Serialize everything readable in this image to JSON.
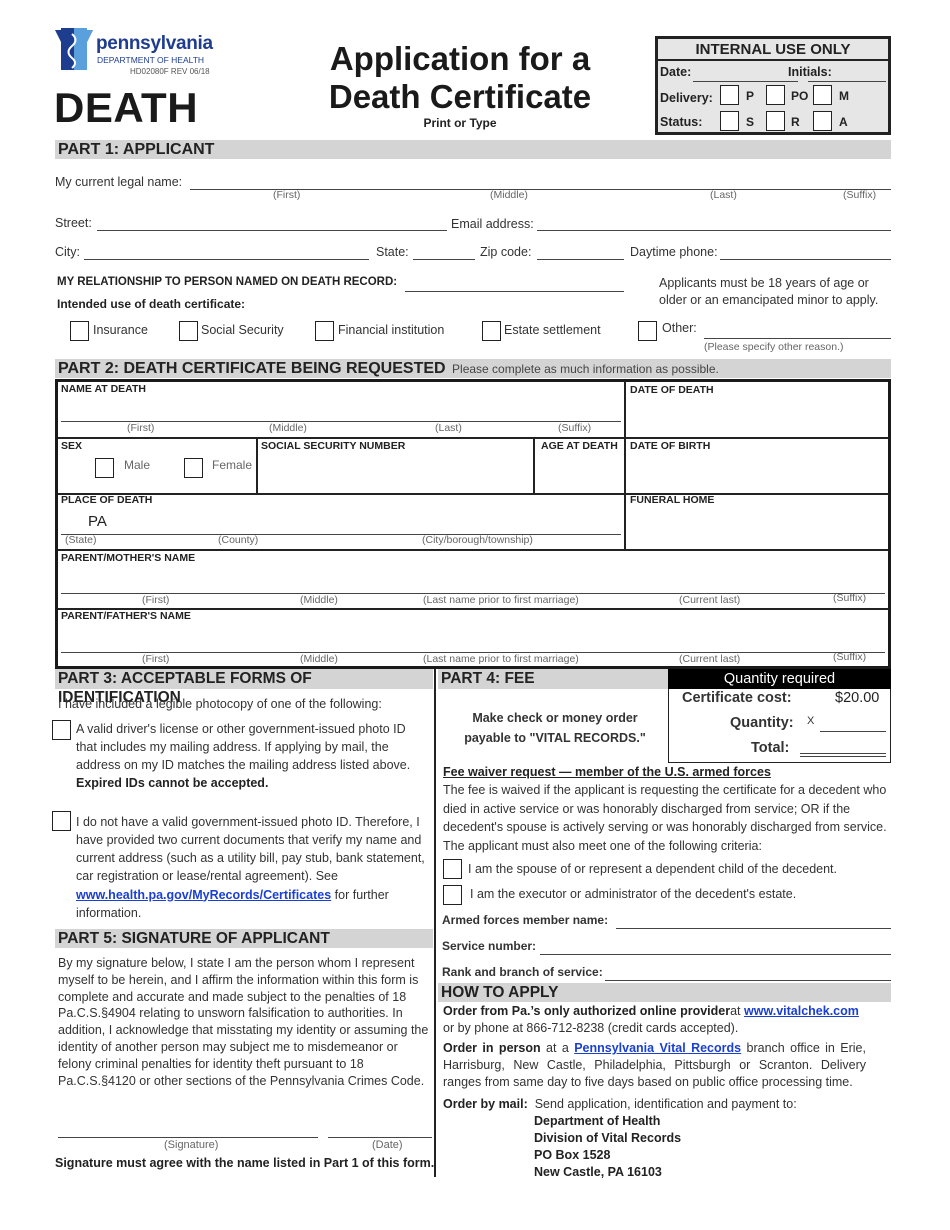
{
  "header": {
    "logo": {
      "name": "pennsylvania",
      "subtitle": "DEPARTMENT OF HEALTH",
      "form_code": "HD02080F REV 06/18"
    },
    "record_type": "DEATH",
    "title_line1": "Application for a",
    "title_line2": "Death Certificate",
    "subtitle": "Print or Type",
    "internal": {
      "title": "INTERNAL USE ONLY",
      "date_label": "Date:",
      "initials_label": "Initials:",
      "delivery_label": "Delivery:",
      "delivery_options": [
        "P",
        "PO",
        "M"
      ],
      "status_label": "Status:",
      "status_options": [
        "S",
        "R",
        "A"
      ]
    }
  },
  "part1": {
    "title": "PART 1: APPLICANT",
    "legal_name_label": "My current legal name:",
    "name_hints": [
      "(First)",
      "(Middle)",
      "(Last)",
      "(Suffix)"
    ],
    "street_label": "Street:",
    "email_label": "Email address:",
    "city_label": "City:",
    "state_label": "State:",
    "zip_label": "Zip code:",
    "phone_label": "Daytime phone:",
    "relationship_label": "MY RELATIONSHIP TO PERSON NAMED ON DEATH RECORD:",
    "age_note_line1": "Applicants must be 18 years of age or",
    "age_note_line2": "older or an emancipated minor to apply.",
    "intended_use_label": "Intended use of death certificate:",
    "uses": [
      "Insurance",
      "Social Security",
      "Financial institution",
      "Estate settlement"
    ],
    "other_label": "Other:",
    "other_hint": "(Please specify other reason.)"
  },
  "part2": {
    "title": "PART 2: DEATH CERTIFICATE BEING REQUESTED",
    "note": "Please complete as much information as possible.",
    "name_at_death": "NAME AT DEATH",
    "name_hints": [
      "(First)",
      "(Middle)",
      "(Last)",
      "(Suffix)"
    ],
    "date_of_death": "DATE OF DEATH",
    "sex": "SEX",
    "sex_options": [
      "Male",
      "Female"
    ],
    "ssn": "SOCIAL SECURITY NUMBER",
    "age_at_death": "AGE AT DEATH",
    "date_of_birth": "DATE OF BIRTH",
    "place_of_death": "PLACE OF DEATH",
    "place_state_value": "PA",
    "place_hints": [
      "(State)",
      "(County)",
      "(City/borough/township)"
    ],
    "funeral_home": "FUNERAL HOME",
    "mother": "PARENT/MOTHER'S NAME",
    "father": "PARENT/FATHER'S NAME",
    "parent_hints": [
      "(First)",
      "(Middle)",
      "(Last name prior to first marriage)",
      "(Current last)",
      "(Suffix)"
    ]
  },
  "part3": {
    "title": "PART 3: ACCEPTABLE FORMS OF IDENTIFICATION",
    "intro": "I have included a legible photocopy of one of the following:",
    "option1": "A valid driver's license or other government-issued photo ID that includes my mailing address. If applying by mail, the address on my ID matches the mailing address listed above.",
    "option1_bold": "Expired IDs cannot be accepted.",
    "option2": "I do not have a valid government-issued photo ID. Therefore, I have provided two current documents that verify my name and current address (such as a utility bill, pay stub, bank statement, car registration or lease/rental agreement). See",
    "option2_link": "www.health.pa.gov/MyRecords/Certificates",
    "option2_end": "for further information."
  },
  "part4": {
    "title": "PART 4: FEE",
    "qty_header": "Quantity required",
    "payable_line1": "Make check or money order",
    "payable_line2": "payable to \"VITAL RECORDS.\"",
    "cost_label": "Certificate cost:",
    "cost_value": "$20.00",
    "quantity_label": "Quantity:",
    "quantity_prefix": "X",
    "total_label": "Total:",
    "waiver_title": "Fee waiver request — member of the U.S. armed forces",
    "waiver_text": "The fee is waived if the applicant is requesting the certificate for a decedent who died in active service or was honorably discharged from service; OR if the decedent's spouse is actively serving or was honorably discharged from service. The applicant must also meet one of the following criteria:",
    "waiver_options": [
      "I am the spouse of or represent a dependent child of the decedent.",
      "I am the executor or administrator of the decedent's estate."
    ],
    "member_name_label": "Armed forces member name:",
    "service_number_label": "Service number:",
    "rank_label": "Rank and branch of service:"
  },
  "how_to_apply": {
    "title": "HOW TO APPLY",
    "online_bold": "Order from Pa.’s only authorized online provider",
    "online_at": "at",
    "online_link": "www.vitalchek.com",
    "online_rest": "or by phone at 866-712-8238 (credit cards accepted).",
    "person_bold": "Order in person",
    "person_at": "at a",
    "person_link": "Pennsylvania Vital Records",
    "person_rest": "branch office in Erie, Harrisburg, New Castle, Philadelphia, Pittsburgh or Scranton.  Delivery ranges from same day to five days based on public office processing time.",
    "mail_bold": "Order by mail:",
    "mail_rest": "Send application, identification and payment to:",
    "address": [
      "Department of Health",
      "Division of Vital Records",
      "PO Box 1528",
      "New Castle, PA 16103"
    ]
  },
  "part5": {
    "title": "PART 5: SIGNATURE OF APPLICANT",
    "text": "By my signature below, I state I am the person whom I represent myself to be herein, and I affirm the information within this form is complete and accurate and made subject to the penalties of 18 Pa.C.S.§4904 relating to unsworn falsification to authorities. In addition, I acknowledge that misstating my identity or assuming the identity of another person may subject me to misdemeanor or felony criminal penalties for identity theft pursuant to 18 Pa.C.S.§4120 or other sections of the Pennsylvania Crimes Code.",
    "signature_hint": "(Signature)",
    "date_hint": "(Date)",
    "note": "Signature must agree with the name listed in Part 1 of this form."
  },
  "colors": {
    "section_bar": "#d4d4d4",
    "link": "#1a3fd1",
    "logo_dark": "#1f3d8f",
    "logo_light": "#5aa0dc"
  }
}
